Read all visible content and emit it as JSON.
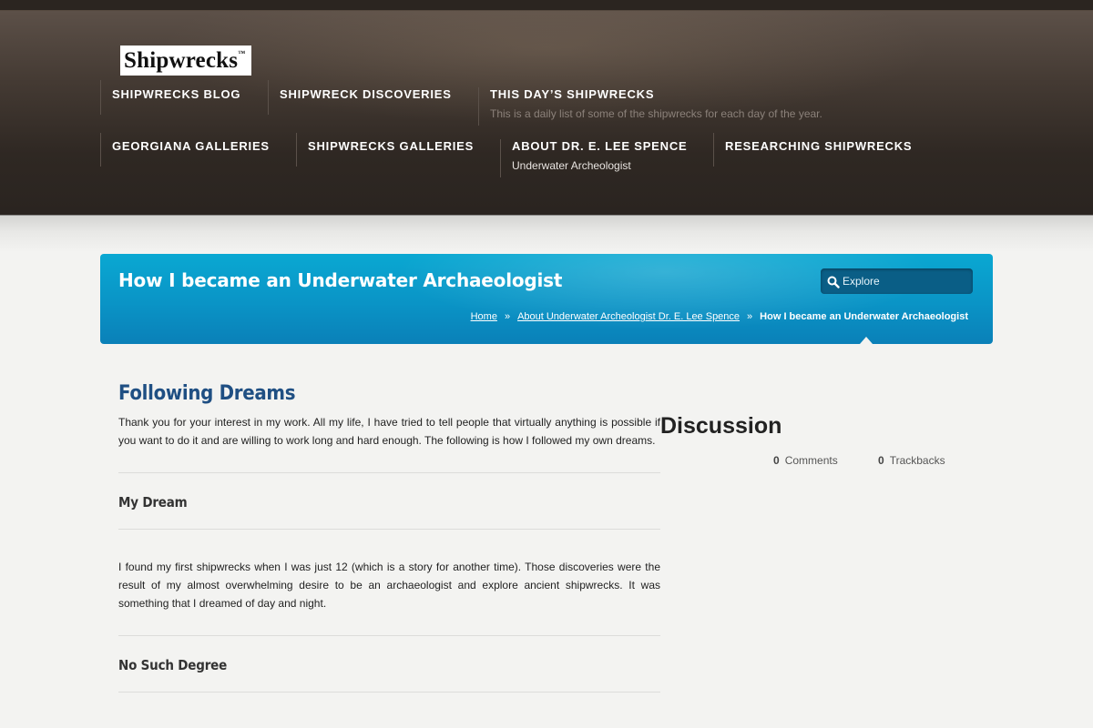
{
  "header": {
    "logo_text": "Shipwrecks",
    "logo_mark": "™",
    "nav": [
      {
        "label": "SHIPWRECKS BLOG",
        "description": ""
      },
      {
        "label": "SHIPWRECK DISCOVERIES",
        "description": ""
      },
      {
        "label": "THIS DAY’S SHIPWRECKS",
        "description": "This is a daily list of some of the shipwrecks for each day of the year."
      },
      {
        "label": "GEORGIANA GALLERIES",
        "description": ""
      },
      {
        "label": "SHIPWRECKS GALLERIES",
        "description": ""
      },
      {
        "label": "ABOUT DR. E. LEE SPENCE",
        "description": "Underwater Archeologist"
      },
      {
        "label": "RESEARCHING SHIPWRECKS",
        "description": ""
      }
    ]
  },
  "banner": {
    "title": "How I became an Underwater Archaeologist",
    "search_placeholder": "Explore",
    "breadcrumb": {
      "home": "Home",
      "separator": "»",
      "parent": "About Underwater Archeologist Dr. E. Lee Spence",
      "current": "How I became an Underwater Archaeologist"
    }
  },
  "content": {
    "heading": "Following Dreams",
    "intro": "Thank you for your interest in my work. All my life, I have tried to tell people that virtually anything is possible if you want to do it and are willing to work long and hard enough. The following is how I followed my own dreams.",
    "section1_title": "My Dream",
    "section1_text": "I found my first shipwrecks when I was just 12 (which is a story for another time). Those discoveries were the result of my almost overwhelming desire to be an archaeologist and explore ancient shipwrecks. It was something that I dreamed of day and night.",
    "section2_title": "No Such Degree"
  },
  "sidebar": {
    "title": "Discussion",
    "comments_count": "0",
    "comments_label": "Comments",
    "trackbacks_count": "0",
    "trackbacks_label": "Trackbacks"
  },
  "colors": {
    "header_bg": "#2f2823",
    "banner_accent": "#0a94c6",
    "heading_blue": "#1f4f83",
    "page_bg": "#f3f3f1"
  }
}
